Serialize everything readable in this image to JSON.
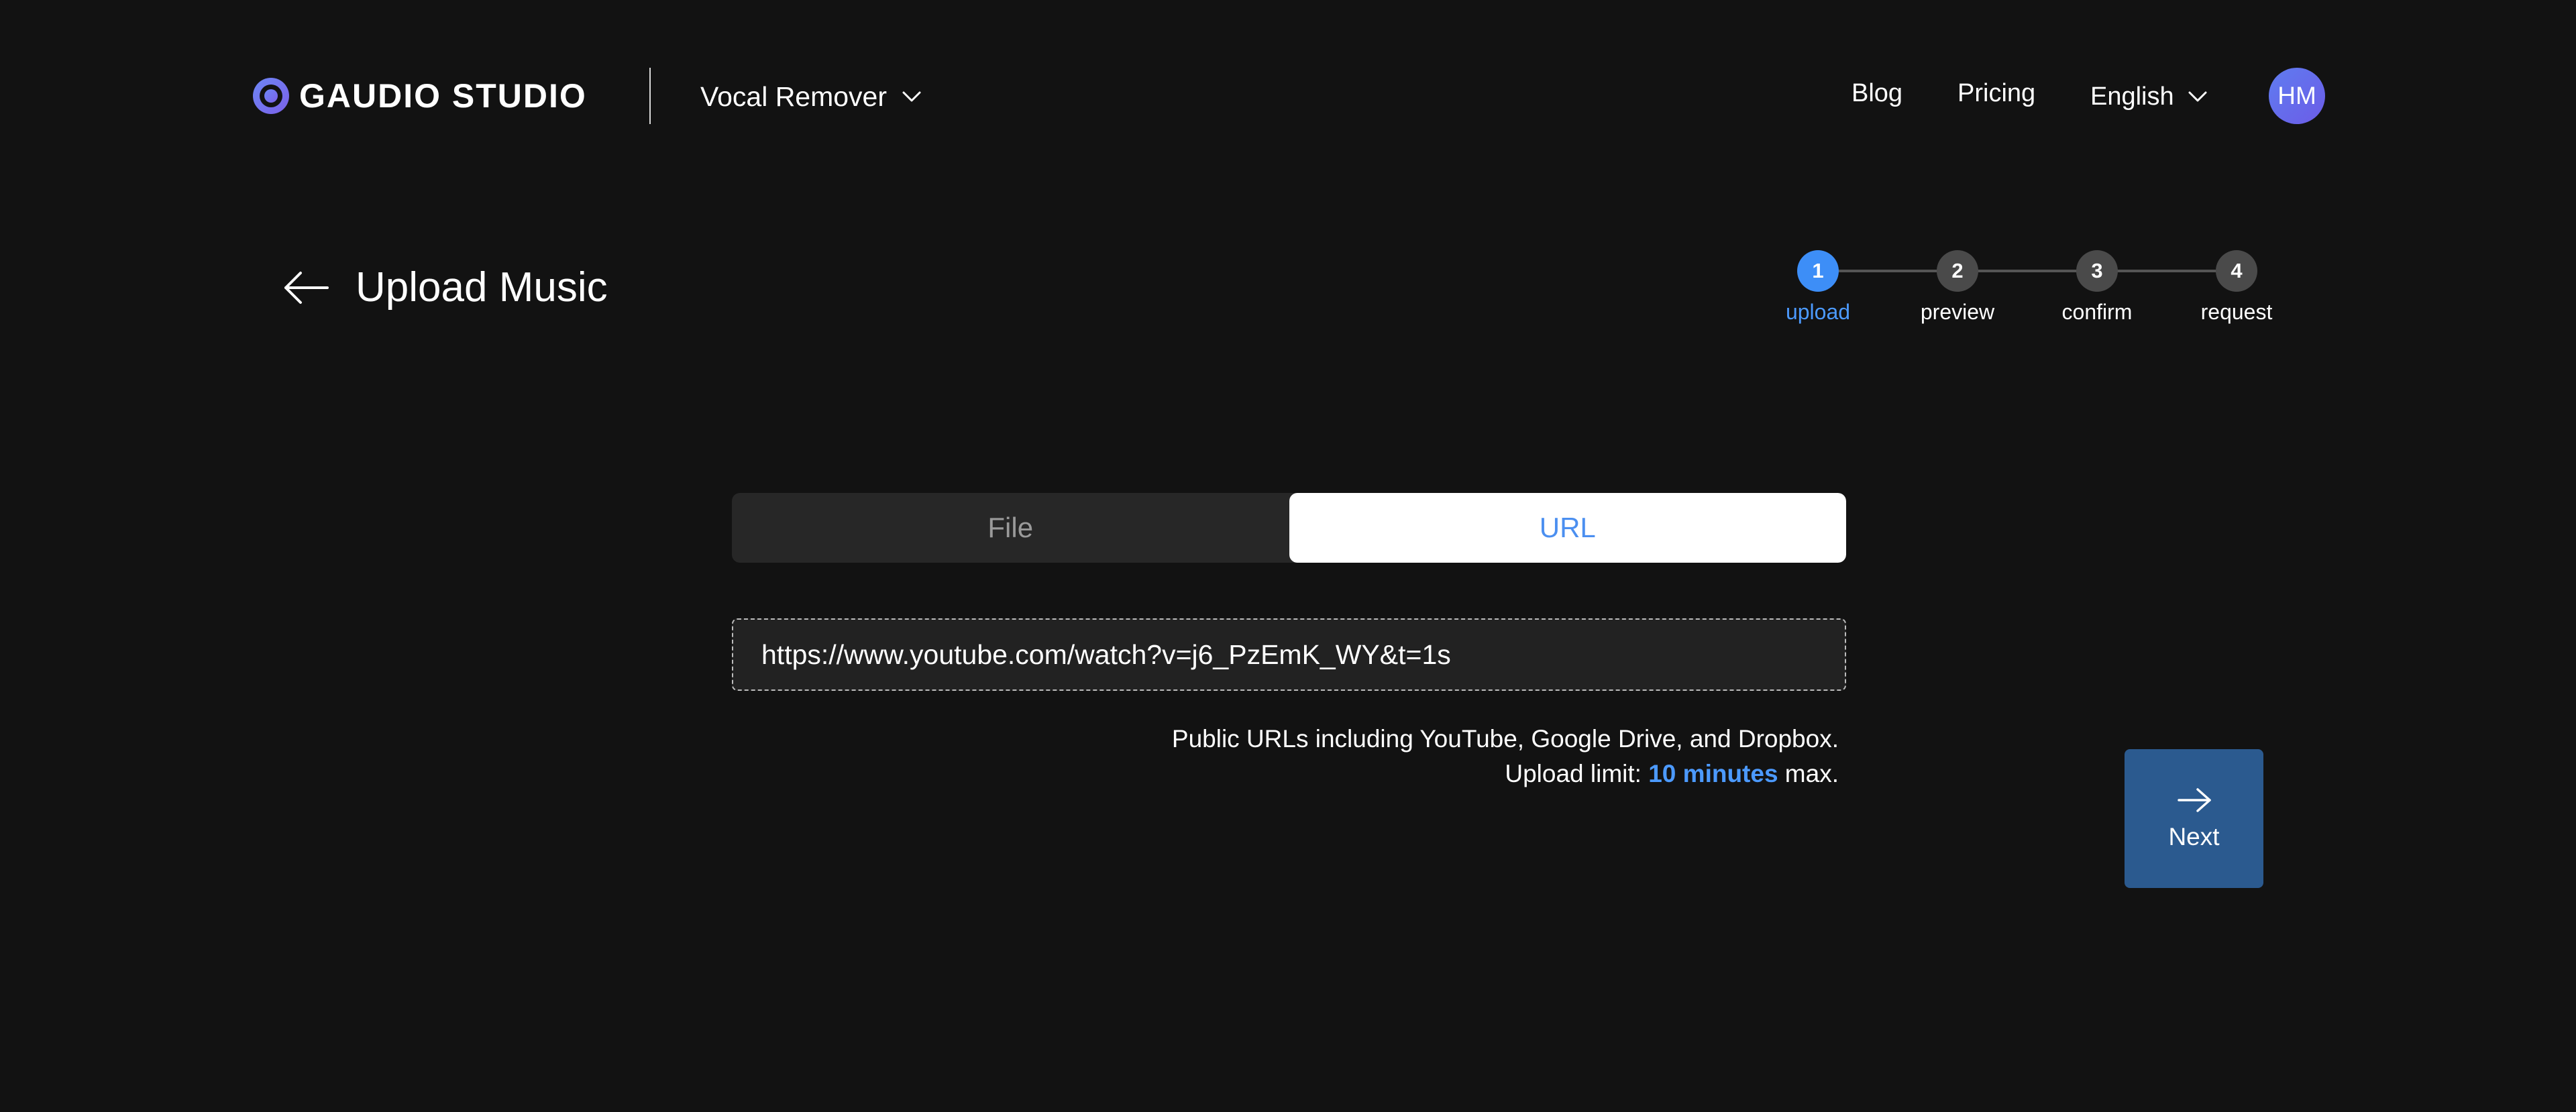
{
  "header": {
    "brand": "GAUDIO STUDIO",
    "product": "Vocal Remover",
    "nav": {
      "blog": "Blog",
      "pricing": "Pricing",
      "language": "English"
    },
    "avatar_initials": "HM"
  },
  "page": {
    "title": "Upload Music"
  },
  "stepper": {
    "active_step": 1,
    "steps": [
      {
        "number": "1",
        "label": "upload"
      },
      {
        "number": "2",
        "label": "preview"
      },
      {
        "number": "3",
        "label": "confirm"
      },
      {
        "number": "4",
        "label": "request"
      }
    ]
  },
  "tabs": {
    "file": "File",
    "url": "URL",
    "selected": "URL"
  },
  "url_input": {
    "value": "https://www.youtube.com/watch?v=j6_PzEmK_WY&t=1s"
  },
  "hint": {
    "line1": "Public URLs including YouTube, Google Drive, and Dropbox.",
    "limit_prefix": "Upload limit: ",
    "limit_value": "10 minutes",
    "limit_suffix": " max."
  },
  "next_button": {
    "label": "Next"
  },
  "colors": {
    "background": "#121212",
    "accent": "#4c9aff",
    "step_active": "#3d8ef7",
    "next_button": "#2b5a8f",
    "avatar_gradient_start": "#5f7cf0",
    "avatar_gradient_end": "#6c5ce7"
  },
  "icons": {
    "logo": "gaudio-logo-icon",
    "product_dropdown": "chevron-down-icon",
    "language_dropdown": "chevron-down-icon",
    "back": "arrow-left-icon",
    "next": "arrow-right-icon"
  }
}
